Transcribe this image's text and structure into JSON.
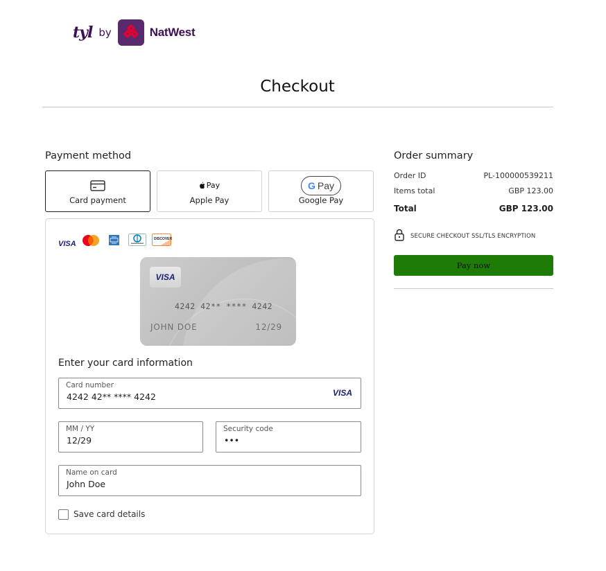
{
  "logo": {
    "tyl": "tyl",
    "by": "by",
    "bank": "NatWest"
  },
  "page_title": "Checkout",
  "payment": {
    "heading": "Payment method",
    "tabs": [
      {
        "label": "Card payment",
        "icon": "card-icon",
        "active": true
      },
      {
        "label": "Apple Pay",
        "icon": "apple-pay-icon",
        "active": false,
        "mark_text": "Pay"
      },
      {
        "label": "Google Pay",
        "icon": "google-pay-icon",
        "active": false,
        "mark_text": "Pay",
        "mark_g": "G"
      }
    ],
    "accepted_brands": [
      "visa",
      "mastercard",
      "amex",
      "diners-club",
      "discover"
    ],
    "brand_text": {
      "visa": "VISA",
      "discover": "DISCOVER"
    },
    "card_preview": {
      "brand": "VISA",
      "number": "4242 42** **** 4242",
      "holder": "JOHN DOE",
      "expiry": "12/29"
    },
    "form_heading": "Enter your card information",
    "fields": {
      "card_number": {
        "label": "Card number",
        "value": "4242 42** **** 4242",
        "brand": "VISA"
      },
      "expiry": {
        "label": "MM / YY",
        "value": "12/29"
      },
      "security_code": {
        "label": "Security code",
        "value": "•••"
      },
      "name": {
        "label": "Name on card",
        "value": "John Doe"
      }
    },
    "save_card": {
      "label": "Save card details",
      "checked": false
    }
  },
  "summary": {
    "heading": "Order summary",
    "order_id_label": "Order ID",
    "order_id": "PL-100000539211",
    "items_total_label": "Items total",
    "items_total": "GBP 123.00",
    "total_label": "Total",
    "total": "GBP 123.00",
    "secure_text": "SECURE CHECKOUT SSL/TLS ENCRYPTION",
    "pay_button": "Pay now"
  },
  "colors": {
    "brand_purple": "#3c1053",
    "pay_green": "#1e7c06",
    "visa_blue": "#1a1f71"
  }
}
